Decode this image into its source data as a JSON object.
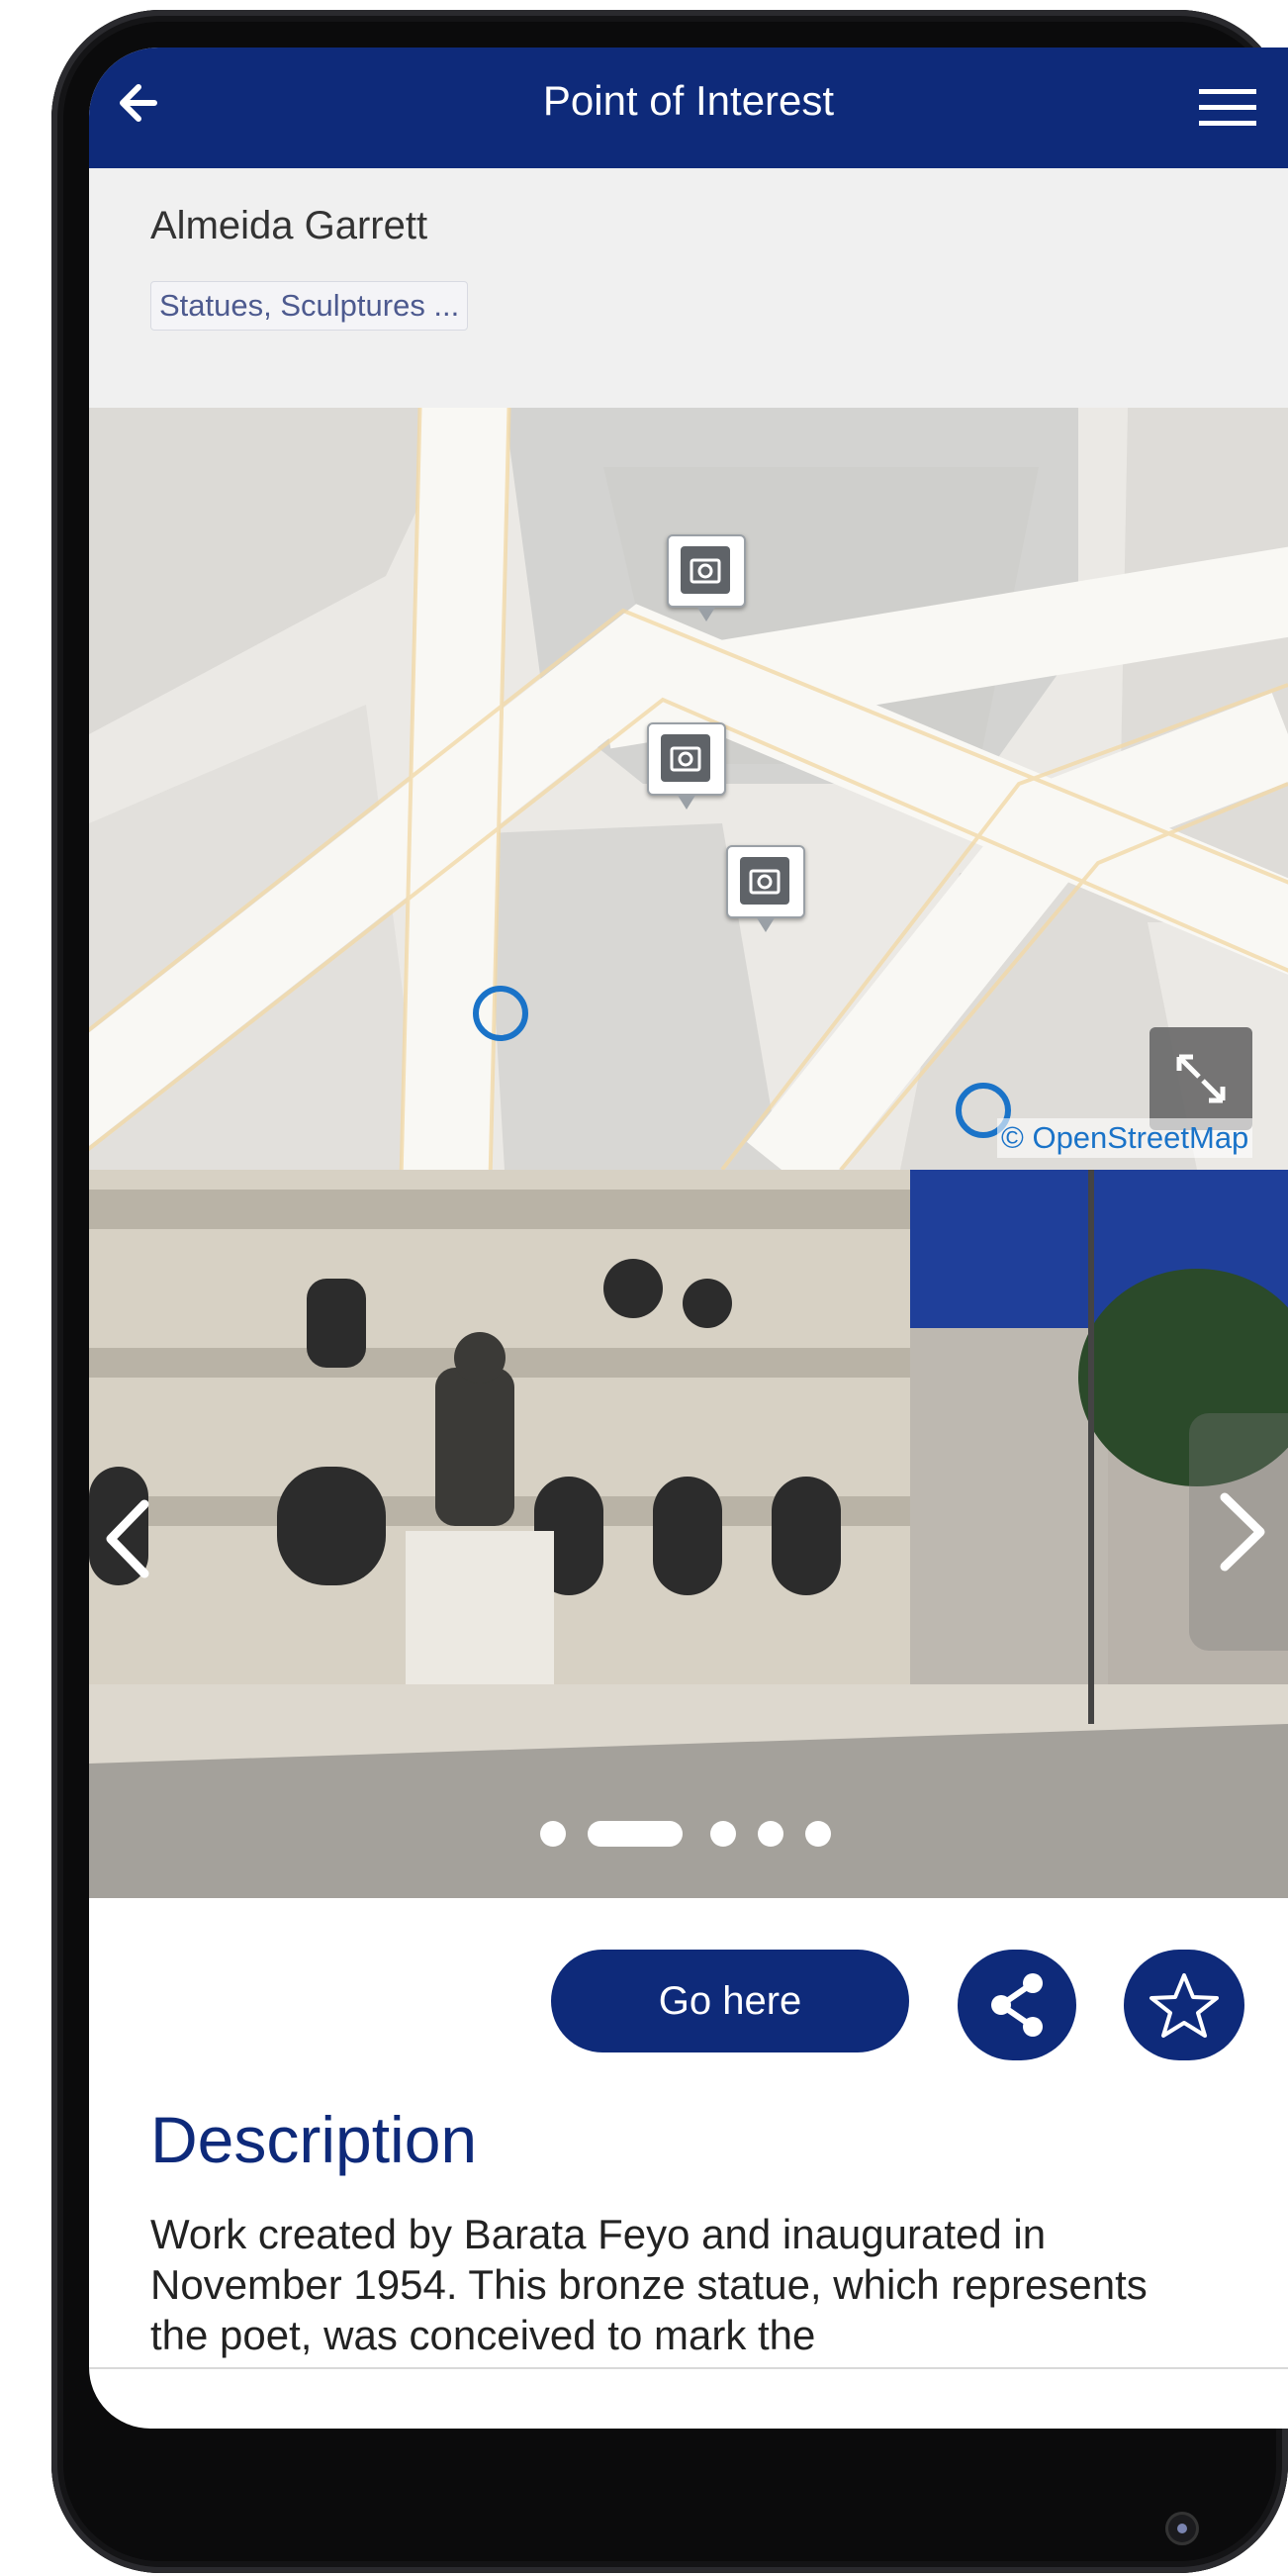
{
  "app_bar": {
    "title": "Point of Interest",
    "back_icon": "arrow-left-icon",
    "menu_icon": "hamburger-menu-icon"
  },
  "poi": {
    "name": "Almeida Garrett",
    "category": "Statues, Sculptures ..."
  },
  "map": {
    "attribution": "© OpenStreetMap",
    "expand_icon": "expand-icon",
    "marker_icon": "camera-icon"
  },
  "gallery": {
    "slide_count": 5,
    "active_slide": 2,
    "prev_icon": "chevron-left-icon",
    "next_icon": "chevron-right-icon"
  },
  "actions": {
    "go_here_label": "Go here",
    "share_icon": "share-icon",
    "favorite_icon": "star-outline-icon"
  },
  "description": {
    "heading": "Description",
    "text": "Work created by Barata Feyo and inaugurated in November 1954. This bronze statue, which represents the poet, was conceived to mark the"
  },
  "colors": {
    "brand_primary": "#0e2a7a",
    "map_location": "#1a73c8",
    "map_background": "#eceae6"
  }
}
